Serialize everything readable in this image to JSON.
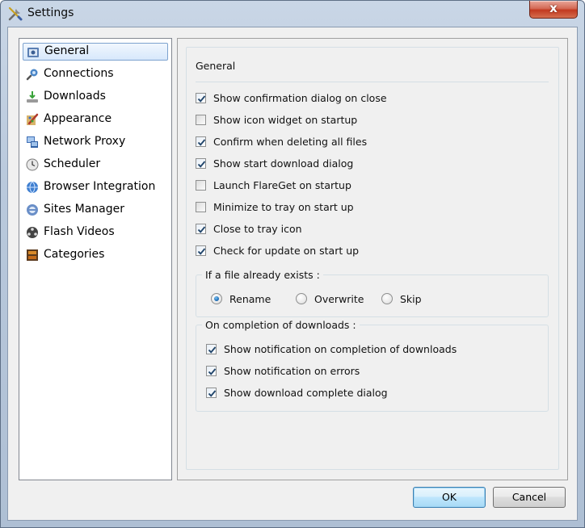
{
  "window": {
    "title": "Settings",
    "close_symbol": "x",
    "icon": "tools-icon",
    "accent": "#3c7fb1"
  },
  "sidebar": {
    "items": [
      {
        "label": "General",
        "icon": "general-settings-icon",
        "selected": true
      },
      {
        "label": "Connections",
        "icon": "connections-icon",
        "selected": false
      },
      {
        "label": "Downloads",
        "icon": "downloads-icon",
        "selected": false
      },
      {
        "label": "Appearance",
        "icon": "appearance-icon",
        "selected": false
      },
      {
        "label": "Network Proxy",
        "icon": "network-proxy-icon",
        "selected": false
      },
      {
        "label": "Scheduler",
        "icon": "scheduler-clock-icon",
        "selected": false
      },
      {
        "label": "Browser Integration",
        "icon": "browser-globe-icon",
        "selected": false
      },
      {
        "label": "Sites Manager",
        "icon": "sites-manager-icon",
        "selected": false
      },
      {
        "label": "Flash Videos",
        "icon": "flash-video-icon",
        "selected": false
      },
      {
        "label": "Categories",
        "icon": "categories-icon",
        "selected": false
      }
    ]
  },
  "general": {
    "section_title": "General",
    "options": [
      {
        "label": "Show confirmation dialog on close",
        "checked": true
      },
      {
        "label": "Show icon widget on startup",
        "checked": false
      },
      {
        "label": "Confirm when deleting all files",
        "checked": true
      },
      {
        "label": "Show start download dialog",
        "checked": true
      },
      {
        "label": "Launch FlareGet on startup",
        "checked": false
      },
      {
        "label": "Minimize to tray on start up",
        "checked": false
      },
      {
        "label": "Close to tray icon",
        "checked": true
      },
      {
        "label": "Check for update on start up",
        "checked": true
      }
    ],
    "file_exists": {
      "title": "If a file already exists :",
      "options": [
        {
          "label": "Rename",
          "selected": true
        },
        {
          "label": "Overwrite",
          "selected": false
        },
        {
          "label": "Skip",
          "selected": false
        }
      ]
    },
    "on_completion": {
      "title": "On completion of downloads :",
      "options": [
        {
          "label": "Show notification on completion of downloads",
          "checked": true
        },
        {
          "label": "Show notification on errors",
          "checked": true
        },
        {
          "label": "Show download complete dialog",
          "checked": true
        }
      ]
    }
  },
  "footer": {
    "ok_label": "OK",
    "cancel_label": "Cancel"
  }
}
